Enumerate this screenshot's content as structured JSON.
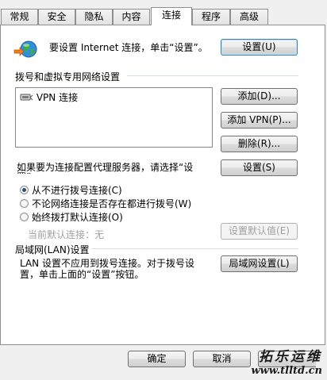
{
  "tabs": [
    {
      "label": "常规"
    },
    {
      "label": "安全"
    },
    {
      "label": "隐私"
    },
    {
      "label": "内容"
    },
    {
      "label": "连接"
    },
    {
      "label": "程序"
    },
    {
      "label": "高级"
    }
  ],
  "setup": {
    "text": "要设置 Internet 连接，单击“设置”。",
    "button": "设置(U)"
  },
  "dialup": {
    "header": "拨号和虚拟专用网络设置",
    "list_items": [
      {
        "label": "VPN 连接"
      }
    ],
    "add_button": "添加(D)...",
    "add_vpn_button": "添加 VPN(P)...",
    "delete_button": "删除(R)...",
    "proxy_text": "如果要为连接配置代理服务器，请选择“设置”。",
    "settings_button": "设置(S)"
  },
  "dial_options": [
    {
      "label": "从不进行拨号连接(C)",
      "checked": true
    },
    {
      "label": "不论网络连接是否存在都进行拨号(W)",
      "checked": false
    },
    {
      "label": "始终拨打默认连接(O)",
      "checked": false
    }
  ],
  "default_connection": {
    "label": "当前默认连接：",
    "value": "无",
    "button": "设置默认值(E)"
  },
  "lan": {
    "header": "局域网(LAN)设置",
    "text": "LAN 设置不应用到拨号连接。对于拨号设置，单击上面的“设置”按钮。",
    "button": "局域网设置(L)"
  },
  "footer": {
    "ok_button": "确定",
    "cancel_button": "取消"
  },
  "watermark": {
    "title": "拓乐运维",
    "url": "www.tlltd.cn"
  }
}
